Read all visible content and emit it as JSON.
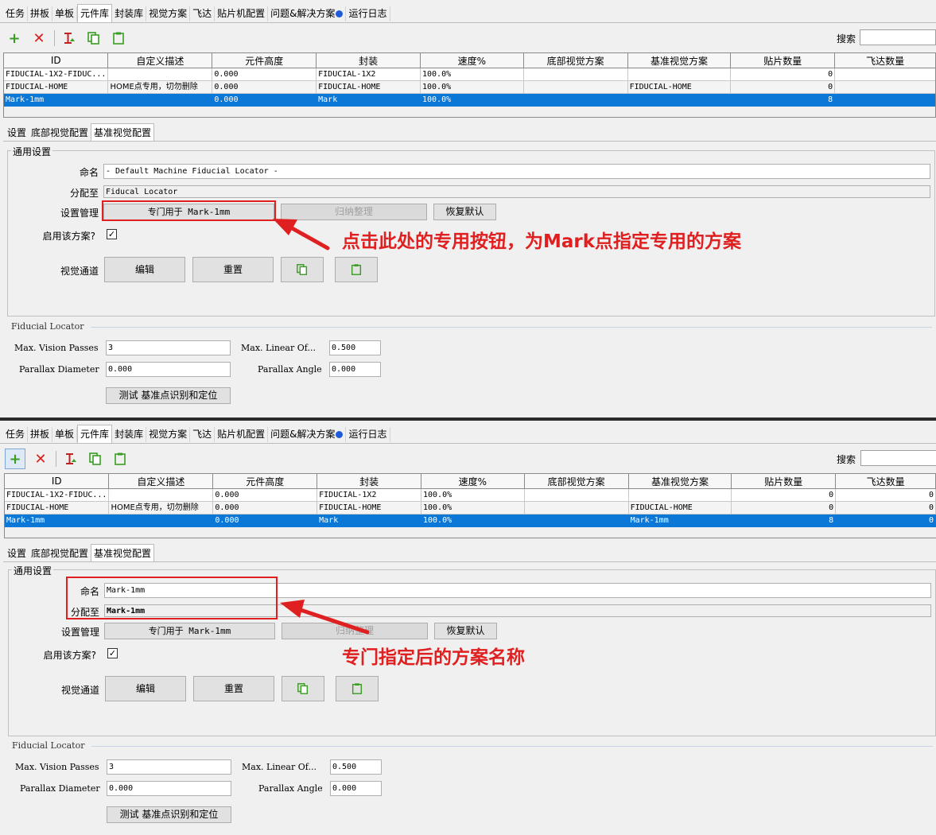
{
  "tabs": [
    "任务",
    "拼板",
    "单板",
    "元件库",
    "封装库",
    "视觉方案",
    "飞达",
    "贴片机配置",
    "问题&解决方案",
    "运行日志"
  ],
  "active_tab": "元件库",
  "search": {
    "label": "搜索",
    "value": ""
  },
  "toolbar": {
    "icons": [
      "add-icon",
      "delete-icon",
      "filter-icon",
      "copy-icon",
      "paste-icon"
    ],
    "colors": {
      "add": "#3a9d23",
      "delete": "#d81e1e",
      "copy": "#3a9d23",
      "paste": "#3a9d23"
    }
  },
  "grid": {
    "columns": [
      "ID",
      "自定义描述",
      "元件高度",
      "封装",
      "速度%",
      "底部视觉方案",
      "基准视觉方案",
      "贴片数量",
      "飞达数量"
    ]
  },
  "panel1": {
    "rows": [
      [
        "FIDUCIAL-1X2-FIDUC...",
        "",
        "0.000",
        "FIDUCIAL-1X2",
        "100.0%",
        "",
        "",
        "0",
        ""
      ],
      [
        "FIDUCIAL-HOME",
        "HOME点专用，切勿删除",
        "0.000",
        "FIDUCIAL-HOME",
        "100.0%",
        "",
        "FIDUCIAL-HOME",
        "0",
        ""
      ],
      [
        "Mark-1mm",
        "",
        "0.000",
        "Mark",
        "100.0%",
        "",
        "",
        "8",
        ""
      ]
    ],
    "name_value": "- Default Machine Fiducial Locator -",
    "assign_value": "Fiducal Locator",
    "annotation": "点击此处的专用按钮，为Mark点指定专用的方案"
  },
  "panel2": {
    "rows": [
      [
        "FIDUCIAL-1X2-FIDUC...",
        "",
        "0.000",
        "FIDUCIAL-1X2",
        "100.0%",
        "",
        "",
        "0",
        "0"
      ],
      [
        "FIDUCIAL-HOME",
        "HOME点专用，切勿删除",
        "0.000",
        "FIDUCIAL-HOME",
        "100.0%",
        "",
        "FIDUCIAL-HOME",
        "0",
        "0"
      ],
      [
        "Mark-1mm",
        "",
        "0.000",
        "Mark",
        "100.0%",
        "",
        "Mark-1mm",
        "8",
        "0"
      ]
    ],
    "name_value": "Mark-1mm",
    "assign_value": "Mark-1mm",
    "annotation": "专门指定后的方案名称"
  },
  "subtabs": [
    "设置",
    "底部视觉配置",
    "基准视觉配置"
  ],
  "active_subtab": "基准视觉配置",
  "settings": {
    "group_title": "通用设置",
    "name_label": "命名",
    "assign_label": "分配至",
    "manage_label": "设置管理",
    "dedicate_button": "专门用于 Mark-1mm",
    "normalize_button": "归纳整理",
    "restore_button": "恢复默认",
    "enable_label": "启用该方案?",
    "enabled": true,
    "vision_label": "视觉通道",
    "edit_button": "编辑",
    "reset_button": "重置"
  },
  "fiducial": {
    "title": "Fiducial Locator",
    "max_passes_label": "Max. Vision Passes",
    "max_passes_value": "3",
    "max_linear_label": "Max. Linear Of...",
    "max_linear_value": "0.500",
    "parallax_diameter_label": "Parallax Diameter",
    "parallax_diameter_value": "0.000",
    "parallax_angle_label": "Parallax Angle",
    "parallax_angle_value": "0.000",
    "test_button": "测试 基准点识别和定位"
  },
  "accent": {
    "selection": "#0b78d7",
    "annotation": "#e02020",
    "status_dot": "#1f5bd8"
  }
}
